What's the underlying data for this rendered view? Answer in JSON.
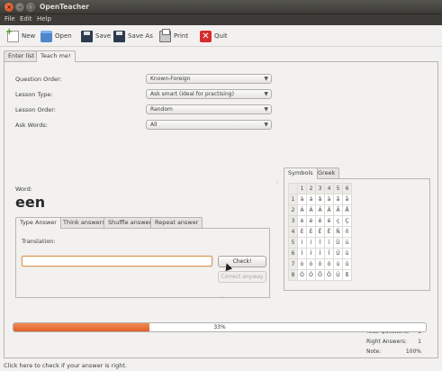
{
  "window": {
    "title": "OpenTeacher"
  },
  "menu": [
    "File",
    "Edit",
    "Help"
  ],
  "toolbar": [
    {
      "label": "New",
      "icon": "new-file-icon"
    },
    {
      "label": "Open",
      "icon": "open-folder-icon"
    },
    {
      "label": "Save",
      "icon": "save-disk-icon"
    },
    {
      "label": "Save As",
      "icon": "save-as-disk-icon"
    },
    {
      "label": "Print",
      "icon": "printer-icon"
    },
    {
      "label": "Quit",
      "icon": "quit-icon"
    }
  ],
  "main_tabs": [
    "Enter list",
    "Teach me!"
  ],
  "settings": [
    {
      "label": "Question Order:",
      "value": "Known-Foreign"
    },
    {
      "label": "Lesson Type:",
      "value": "Ask smart (ideal for practising)"
    },
    {
      "label": "Lesson Order:",
      "value": "Random"
    },
    {
      "label": "Ask Words:",
      "value": "All"
    }
  ],
  "word": {
    "label": "Word:",
    "value": "een"
  },
  "answer_tabs": [
    "Type Answer",
    "Think answers",
    "Shuffle answer",
    "Repeat answer"
  ],
  "type_answer": {
    "translation_label": "Translation:",
    "input_value": "",
    "check_button": "Check!",
    "correct_anyway_button": "Correct anyway"
  },
  "symbol_tabs": [
    "Symbols",
    "Greek"
  ],
  "symbols": {
    "header": [
      "",
      "1",
      "2",
      "3",
      "4",
      "5",
      "6"
    ],
    "rows": [
      [
        "1",
        "à",
        "á",
        "â",
        "ä",
        "ã",
        "å"
      ],
      [
        "2",
        "À",
        "Á",
        "Â",
        "Ä",
        "Ã",
        "Å"
      ],
      [
        "3",
        "è",
        "é",
        "ê",
        "ë",
        "ç",
        "Ç"
      ],
      [
        "4",
        "È",
        "É",
        "Ê",
        "Ë",
        "Ñ",
        "ñ"
      ],
      [
        "5",
        "ì",
        "í",
        "î",
        "ï",
        "Ü",
        "ü"
      ],
      [
        "6",
        "Ì",
        "Í",
        "Î",
        "Ï",
        "Ù",
        "ù"
      ],
      [
        "7",
        "ò",
        "ó",
        "ô",
        "ö",
        "ú",
        "û"
      ],
      [
        "8",
        "Ò",
        "Ó",
        "Ô",
        "Ö",
        "Ú",
        "ß"
      ]
    ]
  },
  "stats": [
    {
      "label": "Total Questions:",
      "value": "1"
    },
    {
      "label": "Right Answers:",
      "value": "1"
    },
    {
      "label": "Note:",
      "value": "100%"
    }
  ],
  "progress": {
    "fraction": 0.33,
    "text": "33%"
  },
  "status": "Click here to check if your answer is right."
}
